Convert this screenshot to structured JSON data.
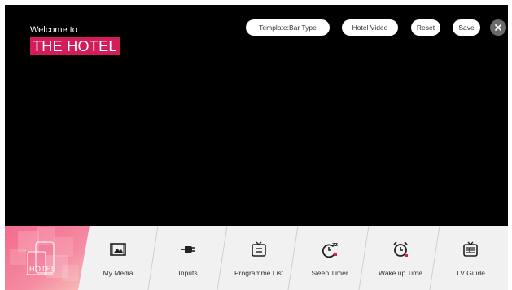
{
  "welcome": {
    "prefix": "Welcome to",
    "title": "THE HOTEL"
  },
  "toolbar": {
    "template_label": "Template:Bar Type",
    "hotel_video_label": "Hotel Video",
    "reset_label": "Reset",
    "save_label": "Save"
  },
  "menu_bar": {
    "hotel_tile_label": "HOTEL",
    "items": [
      {
        "label": "My Media",
        "icon": "media-icon"
      },
      {
        "label": "Inputs",
        "icon": "input-plug-icon"
      },
      {
        "label": "Programme List",
        "icon": "tv-list-icon"
      },
      {
        "label": "Sleep Timer",
        "icon": "sleep-timer-icon"
      },
      {
        "label": "Wake up Time",
        "icon": "alarm-clock-icon"
      },
      {
        "label": "TV Guide",
        "icon": "tv-guide-icon"
      }
    ]
  },
  "colors": {
    "brand": "#d21d5a",
    "hotel_tile": "#f06a8c",
    "background": "#000000",
    "bar": "#f1f1f1"
  }
}
